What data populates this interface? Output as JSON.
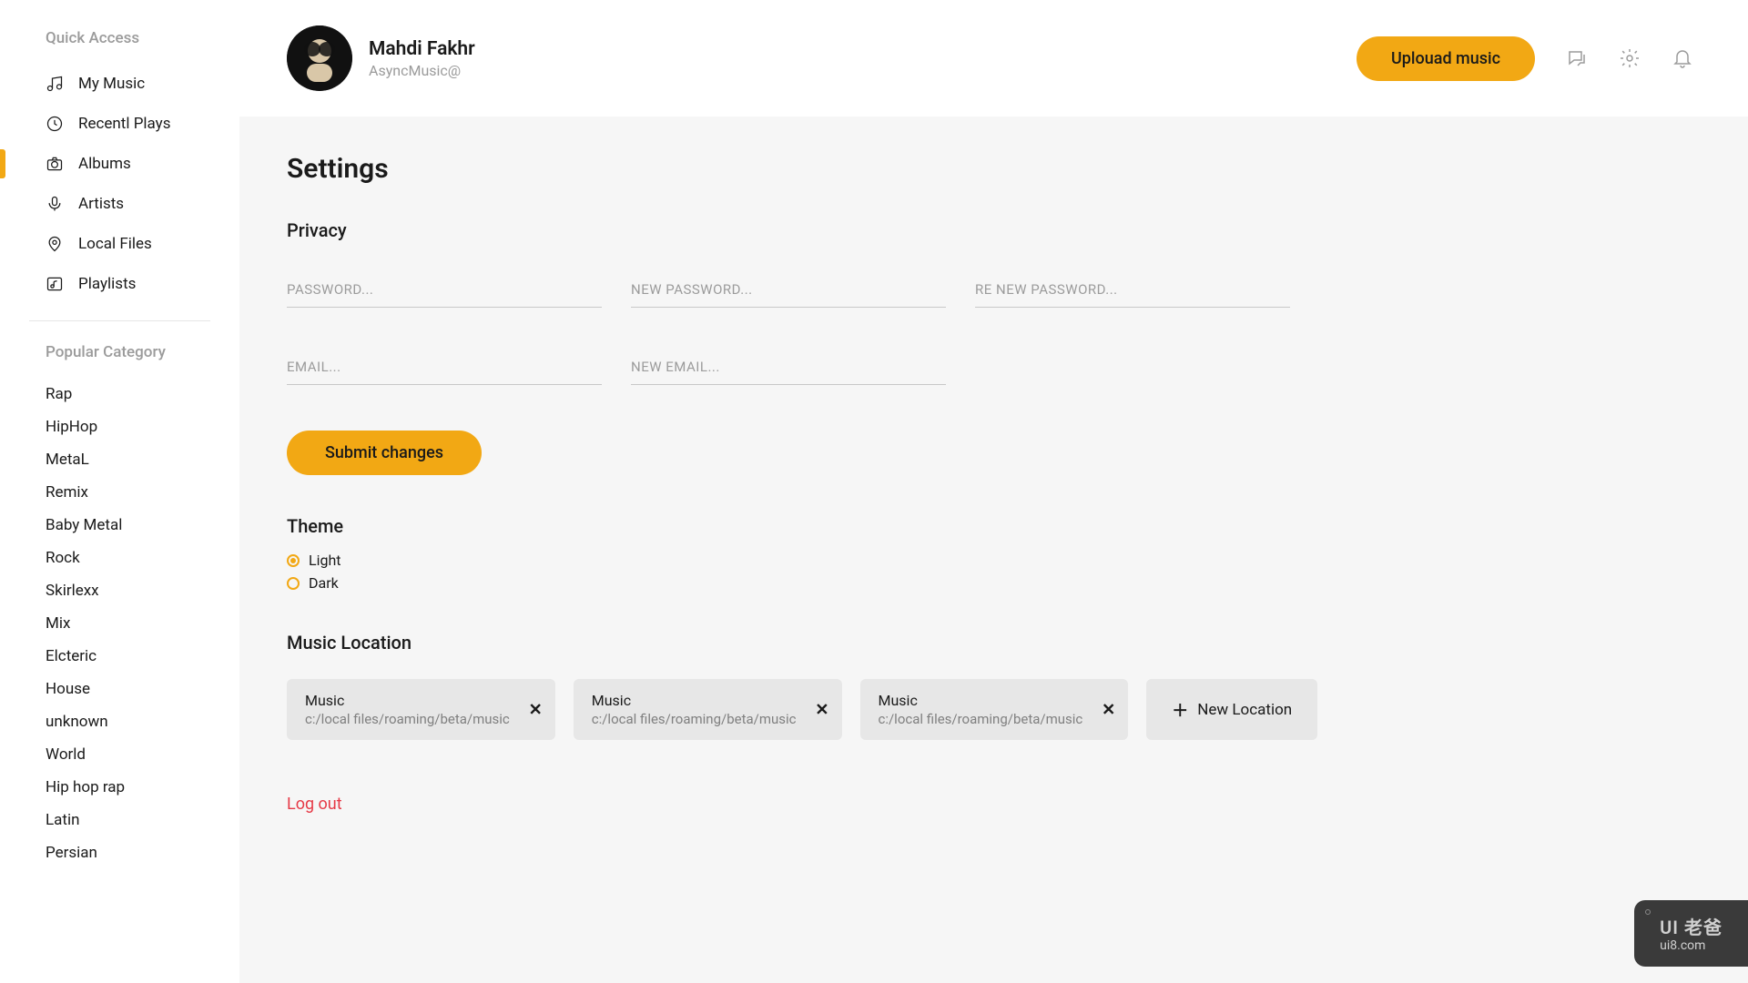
{
  "sidebar": {
    "quick_access_title": "Quick Access",
    "items": [
      {
        "label": "My Music",
        "icon": "music"
      },
      {
        "label": "Recentl Plays",
        "icon": "clock"
      },
      {
        "label": "Albums",
        "icon": "camera",
        "active": true
      },
      {
        "label": "Artists",
        "icon": "mic"
      },
      {
        "label": "Local Files",
        "icon": "pin"
      },
      {
        "label": "Playlists",
        "icon": "playlist"
      }
    ],
    "popular_title": "Popular Category",
    "categories": [
      "Rap",
      "HipHop",
      "MetaL",
      "Remix",
      "Baby Metal",
      "Rock",
      "Skirlexx",
      "Mix",
      "Elcteric",
      "House",
      "unknown",
      "World",
      "Hip hop rap",
      "Latin",
      "Persian"
    ]
  },
  "header": {
    "user_name": "Mahdi Fakhr",
    "user_handle": "AsyncMusic@",
    "upload_label": "Uplouad music"
  },
  "settings": {
    "page_title": "Settings",
    "privacy_title": "Privacy",
    "placeholders": {
      "password": "PASSWORD...",
      "new_password": "NEW PASSWORD...",
      "re_new_password": "RE NEW PASSWORD...",
      "email": "EMAIL...",
      "new_email": "NEW EMAIL..."
    },
    "submit_label": "Submit changes",
    "theme_title": "Theme",
    "theme_options": {
      "light": "Light",
      "dark": "Dark"
    },
    "theme_selected": "light",
    "music_location_title": "Music Location",
    "locations": [
      {
        "title": "Music",
        "path": "c:/local files/roaming/beta/music"
      },
      {
        "title": "Music",
        "path": "c:/local files/roaming/beta/music"
      },
      {
        "title": "Music",
        "path": "c:/local files/roaming/beta/music"
      }
    ],
    "new_location_label": "New Location",
    "logout_label": "Log out"
  },
  "watermark": {
    "top": "UI 老爸",
    "bottom": "ui8.com"
  }
}
